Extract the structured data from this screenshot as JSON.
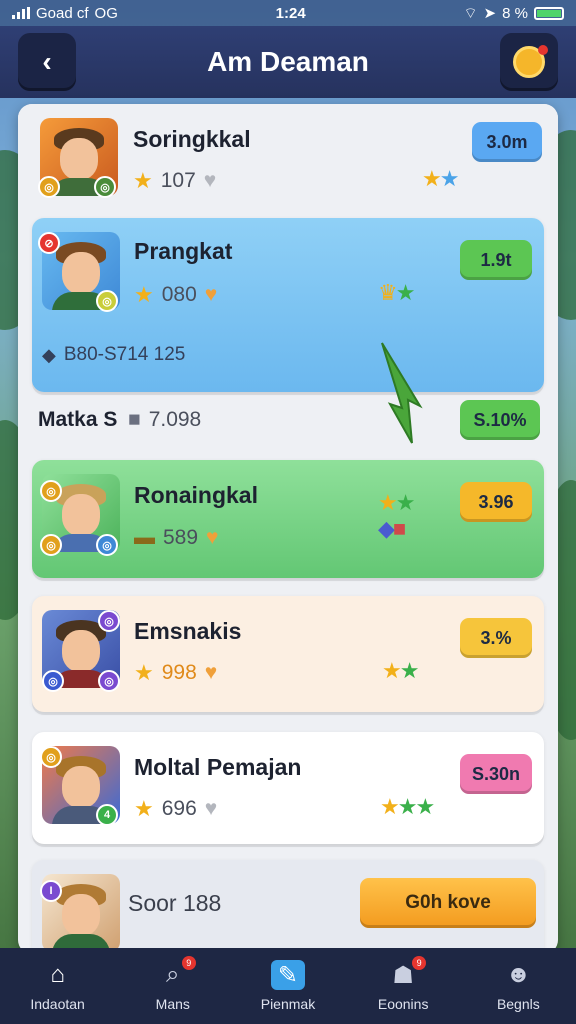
{
  "status_bar": {
    "carrier": "Goad cf",
    "network": "OG",
    "time": "1:24",
    "battery_text": "8 %"
  },
  "header": {
    "title": "Am Deaman",
    "back_icon": "chevron-left-icon",
    "coin_icon": "coin-icon"
  },
  "rows": [
    {
      "name": "Soringkkal",
      "score": "107",
      "button": "3.0m",
      "button_color": "#5aa8f2"
    },
    {
      "name": "Prangkat",
      "score": "080",
      "button": "1.9t",
      "button_color": "#5cc653",
      "extra": "B80-S714 125"
    },
    {
      "name": "Ronaingkal",
      "score": "589",
      "button": "3.96",
      "button_color": "#f5b82a"
    },
    {
      "name": "Emsnakis",
      "score": "998",
      "button": "3.%",
      "button_color": "#f6c53b"
    },
    {
      "name": "Moltal Pemajan",
      "score": "696",
      "button": "S.30n",
      "button_color": "#f07ab0"
    },
    {
      "name": "Soor 188",
      "button": "G0h kove",
      "button_color": "#f7a22c"
    }
  ],
  "middle": {
    "label": "Matka S",
    "value": "7.098",
    "button": "S.10%"
  },
  "nav": [
    {
      "label": "Indaotan",
      "icon": "home-icon"
    },
    {
      "label": "Mans",
      "icon": "search-icon"
    },
    {
      "label": "Pienmak",
      "icon": "edit-icon"
    },
    {
      "label": "Eoonins",
      "icon": "ghost-icon"
    },
    {
      "label": "Begnls",
      "icon": "profile-icon"
    }
  ],
  "colors": {
    "header": "#2f3f74",
    "row_blue": "#7ec6f4",
    "row_green": "#7cd98a",
    "row_peach": "#fcefe2"
  }
}
